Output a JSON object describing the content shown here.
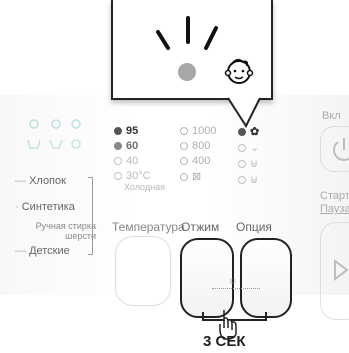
{
  "left_panel": {
    "programs": [
      "Хлопок",
      "Синтетика",
      "Ручная стирка шерсти",
      "Детские"
    ]
  },
  "options": {
    "temperature": {
      "label": "Температура",
      "values": [
        "95",
        "60",
        "40",
        "30°C",
        "Холодная"
      ]
    },
    "spin": {
      "label": "Отжим",
      "values": [
        "1000",
        "800",
        "400"
      ]
    },
    "option": {
      "label": "Опция"
    }
  },
  "right_panel": {
    "power_label": "Вкл",
    "start_label_1": "Старт",
    "start_label_2": "Пауза"
  },
  "hint": {
    "hold_time": "3 СЕК"
  },
  "colors": {
    "accent": "#444444",
    "background": "#ffffff"
  },
  "icons": [
    "baby-face-icon",
    "power-icon",
    "play-pause-icon",
    "hand-pointer-icon",
    "lock-icon"
  ]
}
